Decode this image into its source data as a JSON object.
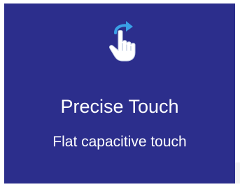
{
  "feature": {
    "icon": "touch-swipe-hand-icon",
    "title": "Precise Touch",
    "subtitle": "Flat capacitive touch"
  },
  "colors": {
    "background": "#2c2e8c",
    "text": "#ffffff",
    "icon_arrow": "#3aa0e6",
    "icon_hand": "#ffffff",
    "icon_hand_shadow": "#c8d2e6"
  }
}
